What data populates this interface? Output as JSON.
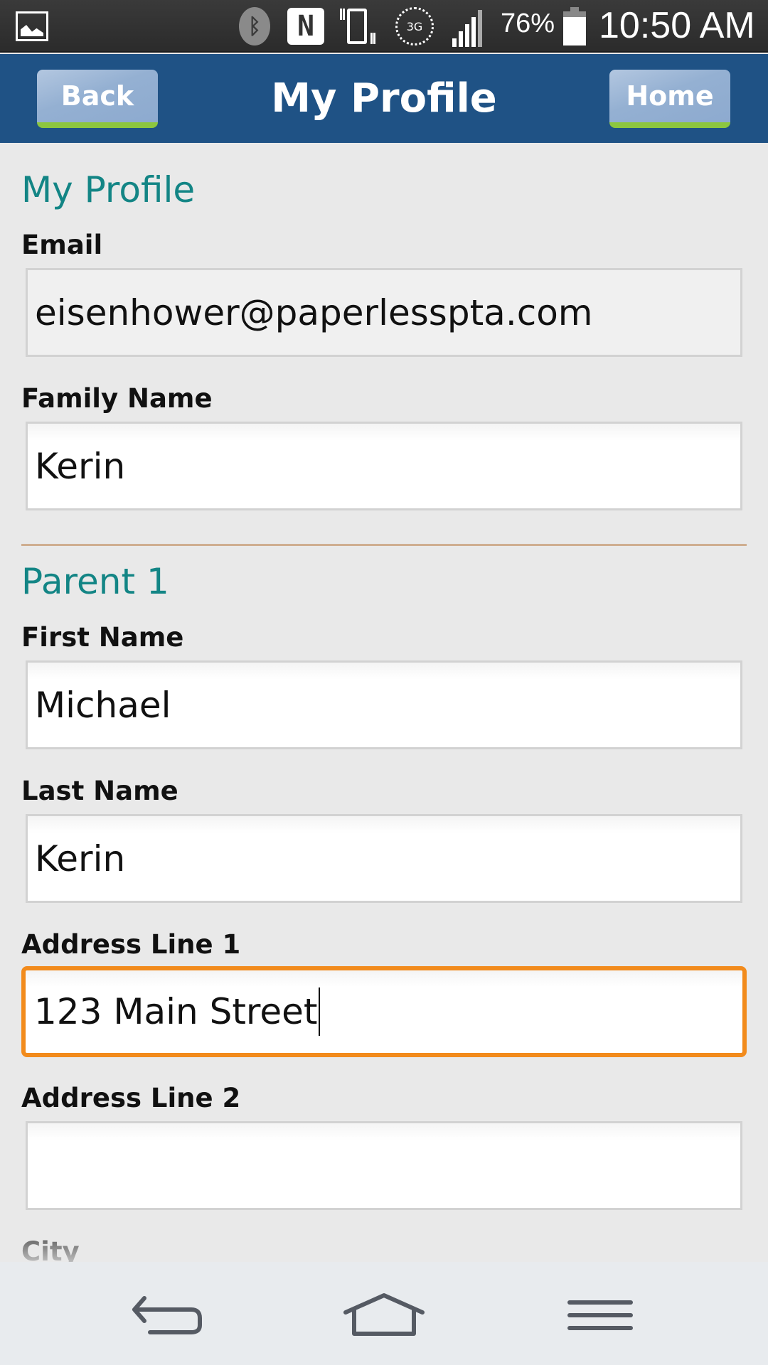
{
  "status_bar": {
    "battery_percent": "76%",
    "battery_level": 0.76,
    "time": "10:50 AM",
    "network_type": "3G",
    "icons": [
      "image-notification-icon",
      "bluetooth-icon",
      "nfc-icon",
      "vibrate-icon",
      "3g-data-icon",
      "signal-icon",
      "battery-icon"
    ]
  },
  "header": {
    "title": "My Profile",
    "back_label": "Back",
    "home_label": "Home",
    "bar_color": "#1f5285",
    "button_accent": "#8cc63f"
  },
  "profile": {
    "section_title": "My Profile",
    "email": {
      "label": "Email",
      "value": "eisenhower@paperlesspta.com"
    },
    "family_name": {
      "label": "Family Name",
      "value": "Kerin"
    }
  },
  "parent1": {
    "section_title": "Parent 1",
    "first_name": {
      "label": "First Name",
      "value": "Michael"
    },
    "last_name": {
      "label": "Last Name",
      "value": "Kerin"
    },
    "address_line_1": {
      "label": "Address Line 1",
      "value": "123 Main Street"
    },
    "address_line_2": {
      "label": "Address Line 2",
      "value": ""
    },
    "city": {
      "label": "City"
    }
  },
  "theme": {
    "section_title_color": "#138585",
    "focus_color": "#f28b1c",
    "divider_color": "#cfae90"
  },
  "nav_bar": {
    "icons": [
      "back-icon",
      "home-icon",
      "menu-icon"
    ]
  }
}
